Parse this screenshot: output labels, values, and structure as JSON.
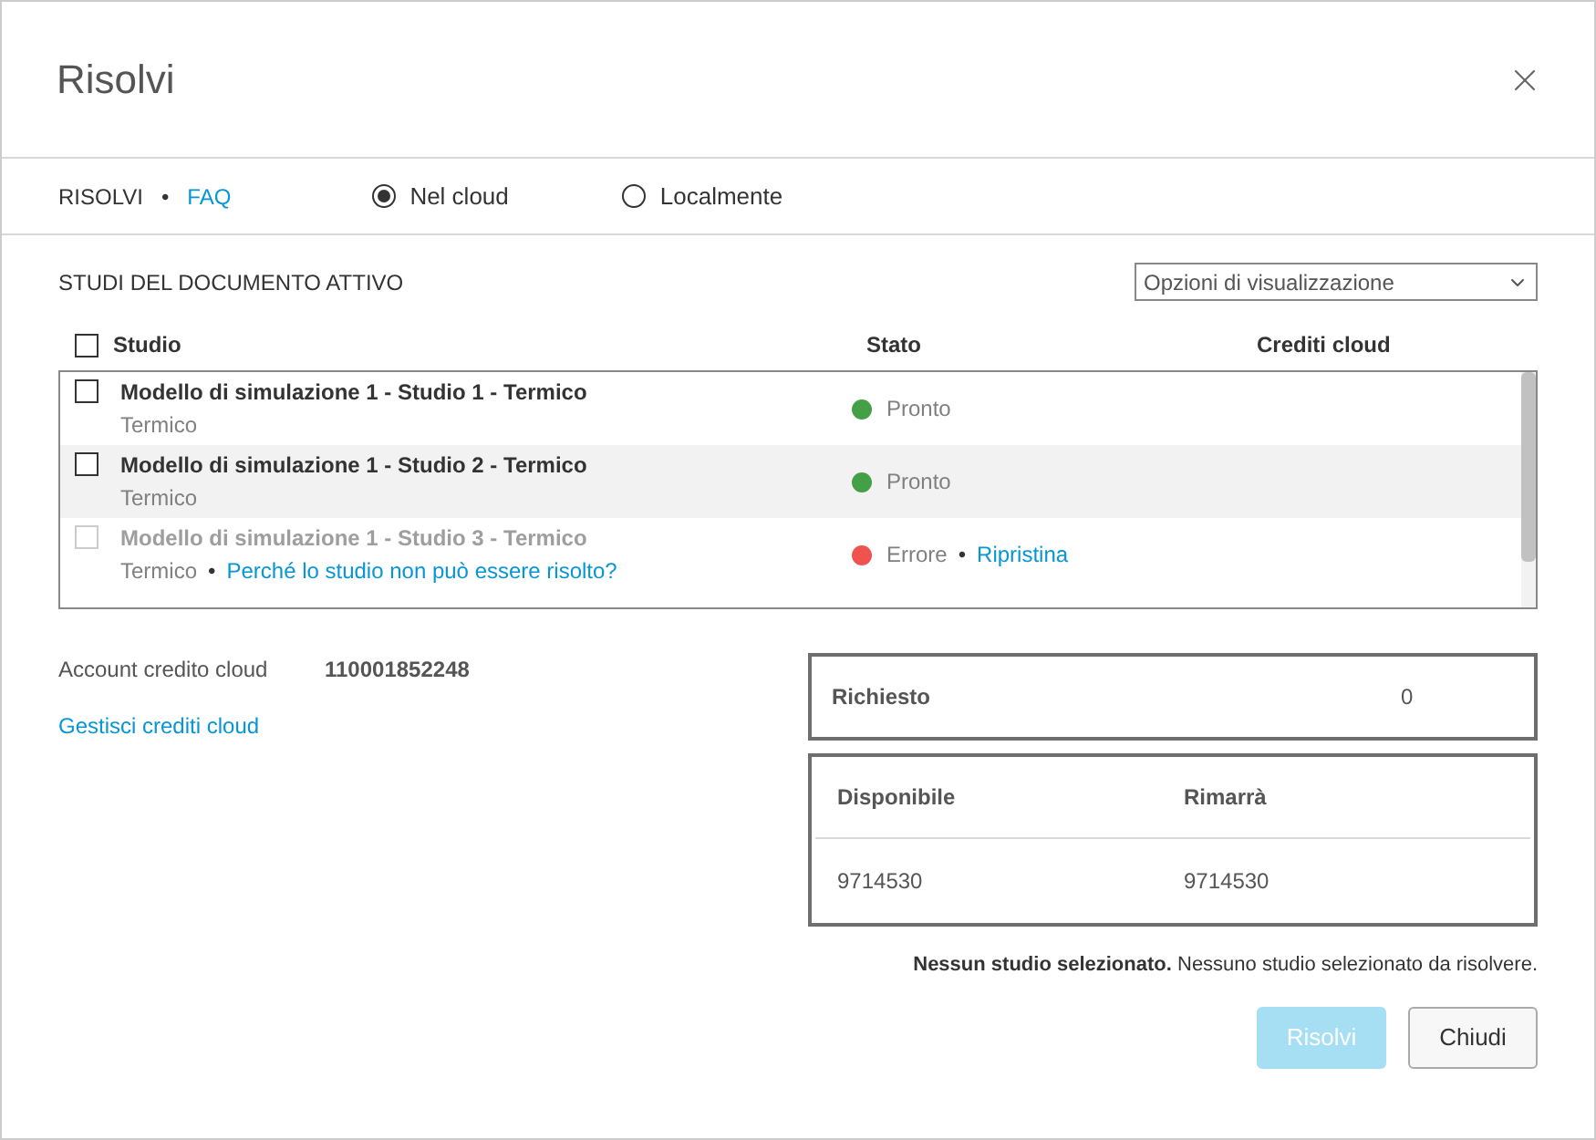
{
  "dialog": {
    "title": "Risolvi"
  },
  "nav": {
    "label": "RISOLVI",
    "separator": "•",
    "link": "FAQ"
  },
  "modes": [
    {
      "label": "Nel cloud",
      "selected": true
    },
    {
      "label": "Localmente",
      "selected": false
    }
  ],
  "section_title": "STUDI DEL DOCUMENTO ATTIVO",
  "view_options": {
    "value": "Opzioni di visualizzazione"
  },
  "table": {
    "select_all": {
      "checked": false
    },
    "columns": [
      "Studio",
      "Stato",
      "Crediti cloud"
    ],
    "rows": [
      {
        "title": "Modello di simulazione 1 - Studio 1 - Termico",
        "type": "Termico",
        "checked": false,
        "disabled": false,
        "status": "Pronto",
        "color": "#43a047"
      },
      {
        "title": "Modello di simulazione 1 - Studio 2 - Termico",
        "type": "Termico",
        "checked": false,
        "disabled": false,
        "status": "Pronto",
        "color": "#43a047"
      },
      {
        "title": "Modello di simulazione 1 - Studio 3 - Termico",
        "type": "Termico",
        "checked": false,
        "disabled": true,
        "separator": "•",
        "help_link": "Perché lo studio non può essere risolto?",
        "status": "Errore",
        "color": "#ef5350",
        "status_separator": "•",
        "action_link": "Ripristina"
      }
    ]
  },
  "account": {
    "label": "Account credito cloud",
    "value": "110001852248",
    "link": "Gestisci crediti cloud"
  },
  "required": {
    "label": "Richiesto",
    "value": "0"
  },
  "balance": {
    "columns": [
      "Disponibile",
      "Rimarrà"
    ],
    "values": [
      "9714530",
      "9714530"
    ]
  },
  "message": "**Nessun studio selezionato.** Nessuno studio selezionato da risolvere.",
  "buttons": [
    {
      "label": "Risolvi",
      "kind": "primary",
      "disabled": true
    },
    {
      "label": "Chiudi",
      "kind": "secondary",
      "disabled": false
    }
  ]
}
